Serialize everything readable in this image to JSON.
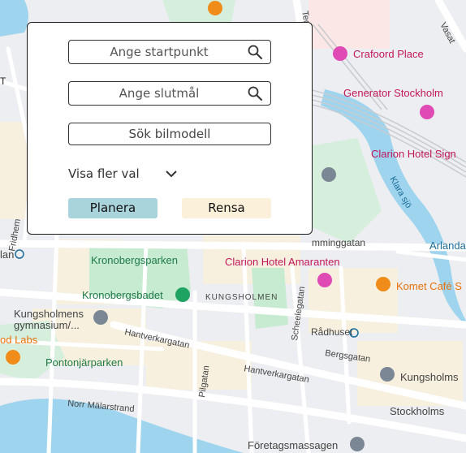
{
  "map": {
    "labels": {
      "crafoord_place": "Crafoord Place",
      "generator_stockholm": "Generator Stockholm",
      "clarion_sign": "Clarion Hotel Sign",
      "klara_sjo": "Klara sjö",
      "arlanda": "Arlanda",
      "kronobergsparken": "Kronobergsparken",
      "clarion_amaranten": "Clarion Hotel Amaranten",
      "komet_cafe": "Komet Café S",
      "kronobergsbadet": "Kronobergsbadet",
      "kungsholmen": "KUNGSHOLMEN",
      "kungsholmens_gym_1": "Kungsholmens",
      "kungsholmens_gym_2": "gymnasium/...",
      "radhuset": "Rådhuset",
      "scheelegatan": "Scheelegatan",
      "bergsgatan": "Bergsgatan",
      "kungsholms": "Kungsholms",
      "hantverkargatan_1": "Hantverkargatan",
      "hantverkargatan_2": "Hantverkargatan",
      "od_labs": "od Labs",
      "pontonjarparken": "Pontonjärparken",
      "pilgatan": "Pilgatan",
      "norr_malarstrand": "Norr Mälarstrand",
      "stockholms": "Stockholms",
      "foretagsmassagen": "Företagsmassagen",
      "fleminggatan": "mminggatan",
      "alan": "lan",
      "fridhem": "Fridhem",
      "vasa": "Vasat",
      "t_label": "T",
      "t_label2": "T",
      "tegn": "Tegn"
    }
  },
  "planner": {
    "start_placeholder": "Ange startpunkt",
    "dest_placeholder": "Ange slutmål",
    "car_model_label": "Sök bilmodell",
    "more_options_label": "Visa fler val",
    "plan_label": "Planera",
    "clear_label": "Rensa"
  }
}
